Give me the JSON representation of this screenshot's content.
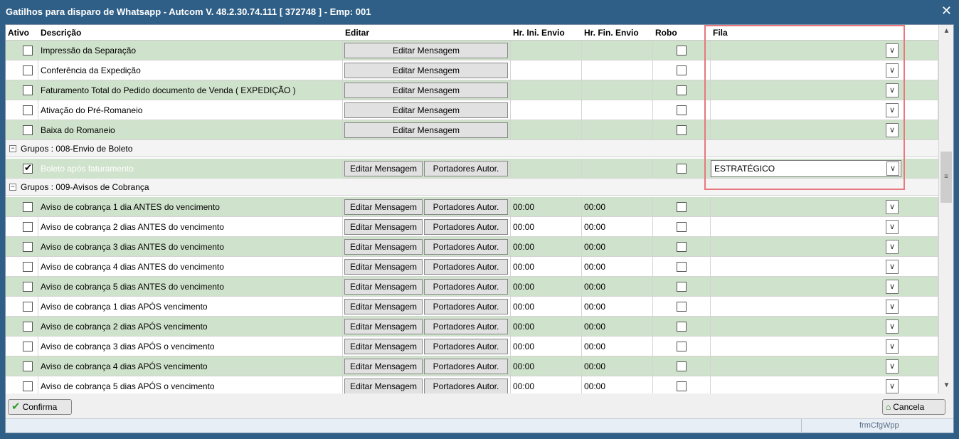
{
  "window": {
    "title": "Gatilhos para disparo de Whatsapp  -  Autcom V. 48.2.30.74.111 [ 372748 ] - Emp: 001",
    "close_glyph": "✕"
  },
  "columns": {
    "ativo": "Ativo",
    "descricao": "Descrição",
    "editar": "Editar",
    "hr_ini": "Hr. Ini. Envio",
    "hr_fin": "Hr. Fin. Envio",
    "robo": "Robo",
    "fila": "Fila"
  },
  "buttons": {
    "editar_mensagem": "Editar Mensagem",
    "portadores": "Portadores Autor."
  },
  "rows_top": [
    {
      "desc": "Impressão da Separação",
      "checked": false
    },
    {
      "desc": "Conferência da Expedição",
      "checked": false
    },
    {
      "desc": "Faturamento Total do Pedido documento de Venda ( EXPEDIÇÃO )",
      "checked": false
    },
    {
      "desc": "Ativação do Pré-Romaneio",
      "checked": false
    },
    {
      "desc": "Baixa do Romaneio",
      "checked": false
    }
  ],
  "group_boleto": {
    "label": "Grupos : 008-Envio de Boleto",
    "row": {
      "desc": "Boleto após faturamento",
      "checked": true,
      "fila": "ESTRATÉGICO"
    }
  },
  "group_cobranca": {
    "label": "Grupos : 009-Avisos de Cobrança",
    "rows": [
      {
        "desc": "Aviso de cobrança 1 dia ANTES do vencimento",
        "hr_ini": "00:00",
        "hr_fin": "00:00"
      },
      {
        "desc": "Aviso de cobrança 2 dias ANTES do vencimento",
        "hr_ini": "00:00",
        "hr_fin": "00:00"
      },
      {
        "desc": "Aviso de cobrança 3 dias ANTES do vencimento",
        "hr_ini": "00:00",
        "hr_fin": "00:00"
      },
      {
        "desc": "Aviso de cobrança 4 dias ANTES do vencimento",
        "hr_ini": "00:00",
        "hr_fin": "00:00"
      },
      {
        "desc": "Aviso de cobrança 5 dias ANTES do vencimento",
        "hr_ini": "00:00",
        "hr_fin": "00:00"
      },
      {
        "desc": "Aviso de cobrança 1 dias APÓS vencimento",
        "hr_ini": "00:00",
        "hr_fin": "00:00"
      },
      {
        "desc": "Aviso de cobrança 2 dias APÓS vencimento",
        "hr_ini": "00:00",
        "hr_fin": "00:00"
      },
      {
        "desc": "Aviso de cobrança 3 dias APÓS o vencimento",
        "hr_ini": "00:00",
        "hr_fin": "00:00"
      },
      {
        "desc": "Aviso de cobrança 4 dias APÓS vencimento",
        "hr_ini": "00:00",
        "hr_fin": "00:00"
      },
      {
        "desc": "Aviso de cobrança 5 dias APÓS o vencimento",
        "hr_ini": "00:00",
        "hr_fin": "00:00"
      }
    ]
  },
  "scrollbar": {
    "up": "▲",
    "grip": "≡",
    "down": "▼"
  },
  "footer": {
    "confirm_label": "Confirma",
    "cancel_label": "Cancela",
    "form_name": "frmCfgWpp"
  },
  "icons": {
    "checkmark": "check-icon",
    "cancel": "cancel-icon",
    "dropdown": "chevron-down-icon",
    "collapse": "minus-icon"
  },
  "colors": {
    "titlebar": "#2f5f86",
    "row_green": "#cfe2cb",
    "highlight": "#e8787f"
  }
}
